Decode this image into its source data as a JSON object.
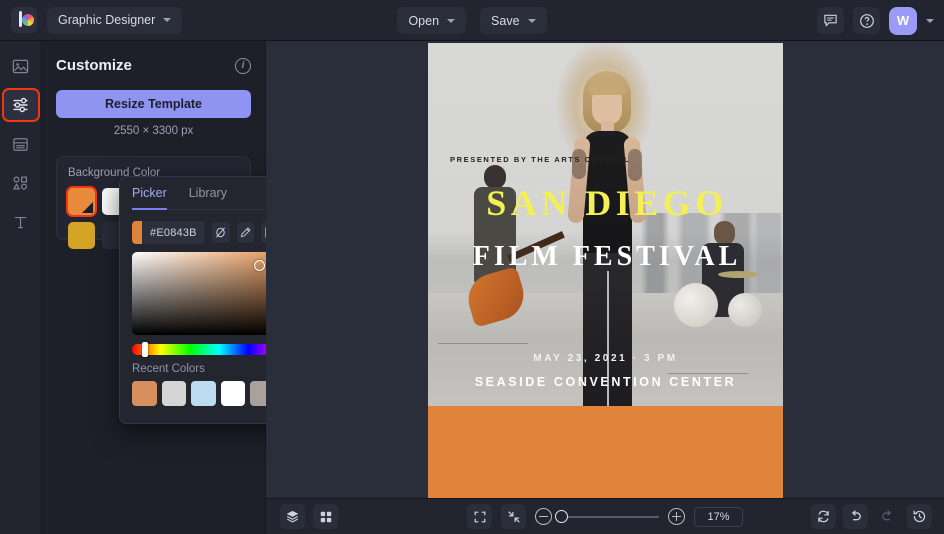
{
  "app": {
    "logo_icon": "color-wheel-logo",
    "document_title": "Graphic Designer"
  },
  "topbar": {
    "open_label": "Open",
    "save_label": "Save",
    "chat_icon": "chat-icon",
    "help_icon": "help-circle-icon",
    "avatar_initial": "W",
    "avatar_color": "#9a9bf5"
  },
  "rail": {
    "items": [
      {
        "name": "image",
        "icon": "image-icon",
        "active": false
      },
      {
        "name": "customize",
        "icon": "sliders-icon",
        "active": true
      },
      {
        "name": "layout",
        "icon": "layout-icon",
        "active": false
      },
      {
        "name": "shapes",
        "icon": "shapes-icon",
        "active": false
      },
      {
        "name": "text",
        "icon": "text-icon",
        "active": false
      }
    ],
    "active_highlight_color": "#f1390d"
  },
  "panel": {
    "title": "Customize",
    "info_icon": "info-icon",
    "resize_label": "Resize Template",
    "resize_color": "#8f93f2",
    "dimensions": "2550 × 3300 px",
    "background_color_label": "Background Color",
    "swatches": [
      {
        "color": "#E98B3C",
        "selected": true
      },
      {
        "color": "#FFFFFF",
        "selected": false
      },
      {
        "color": "#C2143C",
        "selected": false
      },
      {
        "color": "#D4A426",
        "selected": false
      }
    ]
  },
  "picker": {
    "tabs": [
      {
        "label": "Picker",
        "active": true
      },
      {
        "label": "Library",
        "active": false
      }
    ],
    "hex_value": "#E0843B",
    "hex_swatch": "#E0843B",
    "tools": [
      {
        "name": "no-color-icon"
      },
      {
        "name": "eyedropper-icon"
      },
      {
        "name": "palette-grid-icon"
      },
      {
        "name": "add-icon"
      }
    ],
    "recent_label": "Recent Colors",
    "recent_colors": [
      "#D88F5E",
      "#D5D5D5",
      "#BCDCF2",
      "#FFFFFF",
      "#A9A29C",
      "#CC7A26"
    ]
  },
  "canvas": {
    "background_color": "#E0843B",
    "title_line_1": "SAN DIEGO",
    "title_line_1_color": "#f3f055",
    "title_line_2": "FILM FESTIVAL",
    "title_line_2_color": "#ffffff",
    "date_line": "MAY 23, 2021 · 3 PM",
    "venue_line": "SEASIDE CONVENTION CENTER",
    "footer_line": "PRESENTED BY THE ARTS COUNCIL"
  },
  "bottombar": {
    "layers_icon": "layers-icon",
    "grid_icon": "grid-icon",
    "fullscreen_icon": "fit-screen-icon",
    "collapse_icon": "collapse-icon",
    "zoom_out_icon": "zoom-out-icon",
    "zoom_in_icon": "zoom-in-icon",
    "zoom_level": "17%",
    "reset_icon": "reset-icon",
    "undo_icon": "undo-icon",
    "redo_icon": "redo-icon",
    "history_icon": "history-icon"
  }
}
